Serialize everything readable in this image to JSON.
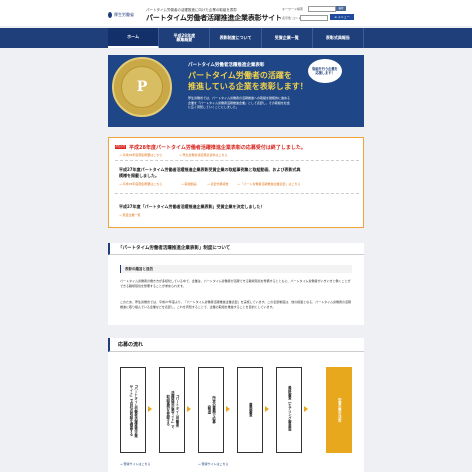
{
  "header": {
    "logo_text": "厚生労働省",
    "sub_title": "パートタイム労働者の活躍推進に向けた企業の取組を表彰",
    "site_title": "パートタイム労働者活躍推進企業表彰サイト",
    "keyword_label": "キーワード検索",
    "search_button": "検索",
    "contrast_label": "表示色 コントラスト調整",
    "menu_button": "≡ メニュー"
  },
  "nav": {
    "items": [
      {
        "label": "ホーム"
      },
      {
        "label": "平成28年度\n募集概要"
      },
      {
        "label": "表彰制度について"
      },
      {
        "label": "受賞企業一覧"
      },
      {
        "label": "表彰式典報告"
      }
    ]
  },
  "hero": {
    "badge_letter": "P",
    "small_title": "パートタイム労働者活躍推進企業表彰",
    "line1": "パートタイム労働者の活躍を",
    "line2": "推進している企業を表彰します！",
    "description": "厚生労働省では、パートタイム労働者の活躍推進への取組を積極的に進める企業を「パートタイム労働者活躍推進企業」として表彰し、その取組を社会に広く周知していくことにしました。",
    "bubble": "取組を行う企業を\n応援します！"
  },
  "notices": {
    "tag": "お知らせ",
    "n1_title": "平成28年度パートタイム労働者活躍推進企業表彰の応募受付は終了しました。",
    "n1_link1": "→ 平成28年度募集概要はこちら",
    "n1_link2": "→ 厚生労働省報道発表資料はこちら",
    "n2_title_a": "平成27年度パートタイム労働者活躍推進企業表彰受賞企業の取組事例集と取組動画、および表彰式典",
    "n2_title_b": "模様を掲載しました。",
    "n2_link1": "→ 平成28年度募集概要はこちら",
    "n2_link2": "→ 取組動画",
    "n2_link3": "→ 表彰式典報告",
    "n2_link4": "→ 「パート労働者活躍推進企業表彰」はこちら",
    "n3_title": "平成27年度「パートタイム労働者活躍推進企業表彰」受賞企業を決定しました！",
    "n3_link": "→ 受賞企業一覧"
  },
  "about": {
    "title": "「パートタイム労働者活躍推進企業表彰」制度について",
    "subtitle": "表彰の趣旨と目的",
    "p1": "パートタイム労働者の働き方が多様化している中で、企業は、パートタイム労働者が活躍できる職場環境を整備するとともに、パートタイム労働者がいきいきと働くことができる職場環境を整備することが求められます。",
    "p2": "このため、厚生労働省では、平成27年度より、「パートタイム労働者活躍推進企業表彰」を実施しています。この表彰制度は、他の模範となる、パートタイム労働者の活躍推進に取り組んでいる企業などを表彰し、これを周知することで、企業の取組を推進することを目的としています。"
  },
  "flow": {
    "title": "応募の流れ",
    "steps": [
      "「パートタイム労働者活躍推進企業\nサイト」で自社の取組を確認する",
      "「パートタイム労働者\n活躍推進企業サイト」で\n取組事例を登録する",
      "所定の書類で応募\n（郵送）",
      "書面審査",
      "最終審査（ヒアリング審査等）",
      "受賞企業の決定"
    ],
    "link1": "→ 登録サイトはこちら",
    "link2": "→ 登録サイトはこちら"
  }
}
